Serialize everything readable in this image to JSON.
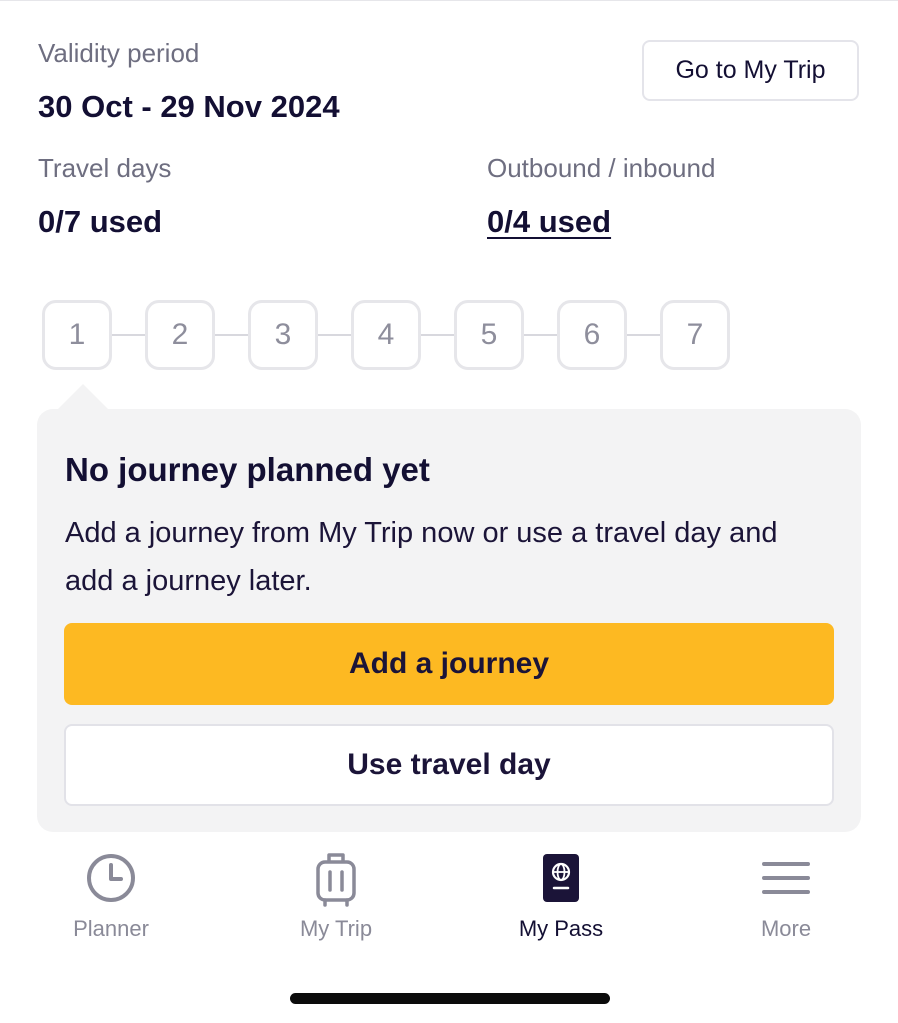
{
  "validity": {
    "label": "Validity period",
    "value": "30 Oct - 29 Nov 2024",
    "goto_button": "Go to My Trip"
  },
  "travel_days": {
    "label": "Travel days",
    "value": "0/7 used"
  },
  "outbound": {
    "label": "Outbound / inbound",
    "value": "0/4 used"
  },
  "days": [
    "1",
    "2",
    "3",
    "4",
    "5",
    "6",
    "7"
  ],
  "card": {
    "title": "No journey planned yet",
    "description": "Add a journey from My Trip now or use a travel day and add a journey later.",
    "primary_button": "Add a journey",
    "secondary_button": "Use travel day"
  },
  "tabs": [
    {
      "label": "Planner",
      "icon": "clock-icon"
    },
    {
      "label": "My Trip",
      "icon": "luggage-icon"
    },
    {
      "label": "My Pass",
      "icon": "passport-icon",
      "active": true
    },
    {
      "label": "More",
      "icon": "menu-icon"
    }
  ],
  "colors": {
    "accent": "#fdb922",
    "text_dark": "#130f33",
    "muted": "#6e6e80",
    "card_bg": "#f3f3f4"
  }
}
